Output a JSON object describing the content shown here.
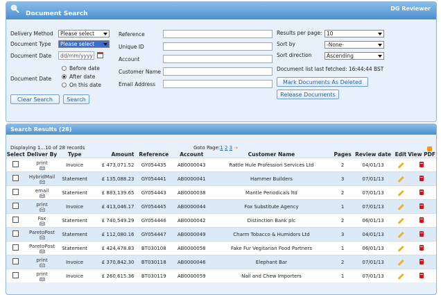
{
  "search_panel": {
    "title": "Document Search",
    "user": "DG Reviewer",
    "delivery_method_label": "Delivery Method",
    "delivery_method_value": "Please select",
    "document_type_label": "Document Type",
    "document_type_value": "Please select",
    "document_date_label": "Document Date",
    "document_date_placeholder": "dd/mm/yyyy",
    "document_date_label2": "Document Date",
    "radio_before": "Before date",
    "radio_after": "After date",
    "radio_on": "On this date",
    "clear_button": "Clear Search",
    "search_button": "Search",
    "reference_label": "Reference",
    "unique_id_label": "Unique ID",
    "account_label": "Account",
    "customer_name_label": "Customer Name",
    "email_label": "Email Address",
    "results_per_page_label": "Results per page:",
    "results_per_page_value": "10",
    "sort_by_label": "Sort by",
    "sort_by_value": "-None-",
    "sort_direction_label": "Sort direction",
    "sort_direction_value": "Ascending",
    "last_fetched": "Document list last fetched: 16:44:44 BST",
    "mark_deleted_button": "Mark Documents As Deleted",
    "release_button": "Release Documents"
  },
  "results": {
    "title": "Search Results (28)",
    "displaying": "Displaying 1...10 of 28 records",
    "goto_label": "Goto Page:",
    "pages": [
      "1",
      "2",
      "3"
    ],
    "columns": [
      "Select",
      "Deliver By",
      "Type",
      "Amount",
      "Reference",
      "Account",
      "Customer Name",
      "Pages",
      "Review date",
      "Edit",
      "View PDF"
    ],
    "rows": [
      {
        "deliver": "print",
        "type": "Invoice",
        "amount": "£ 473,071.52",
        "reference": "GY054435",
        "account": "AB0000043",
        "customer": "Rattle Hule Profession Services Ltd",
        "pages": "2",
        "review_date": "04/01/13"
      },
      {
        "deliver": "HybridMail",
        "type": "Statement",
        "amount": "£ 135,088.23",
        "reference": "GY054441",
        "account": "AB0000041",
        "customer": "Hammer Builders",
        "pages": "3",
        "review_date": "07/01/13"
      },
      {
        "deliver": "email",
        "type": "Statement",
        "amount": "£ 883,139.65",
        "reference": "GY054443",
        "account": "AB0000038",
        "customer": "Mantle Periodicals ltd",
        "pages": "2",
        "review_date": "07/01/13"
      },
      {
        "deliver": "print",
        "type": "Invoice",
        "amount": "£ 413,046.17",
        "reference": "GY054445",
        "account": "AB0000044",
        "customer": "Fox Substitute Agency",
        "pages": "1",
        "review_date": "07/01/13"
      },
      {
        "deliver": "Fax",
        "type": "Statement",
        "amount": "£ 740,549.29",
        "reference": "GY054446",
        "account": "AB0000042",
        "customer": "Distinction Bank plc",
        "pages": "2",
        "review_date": "06/01/13"
      },
      {
        "deliver": "ParetoPost",
        "type": "Statement",
        "amount": "£ 112,080.16",
        "reference": "GY054447",
        "account": "AB0000049",
        "customer": "Charm Tobacco & Humidors Ltd",
        "pages": "3",
        "review_date": "04/01/13"
      },
      {
        "deliver": "ParetoPost",
        "type": "Statement",
        "amount": "£ 424,478.83",
        "reference": "BT030108",
        "account": "AB0000058",
        "customer": "Fake Fur Vegitarian Food Partners",
        "pages": "1",
        "review_date": "06/01/13"
      },
      {
        "deliver": "print",
        "type": "Invoice",
        "amount": "£ 370,842.30",
        "reference": "BT030118",
        "account": "AB0000046",
        "customer": "Elephant Bar",
        "pages": "2",
        "review_date": "07/01/13"
      },
      {
        "deliver": "print",
        "type": "Invoice",
        "amount": "£ 260,615.36",
        "reference": "BT030119",
        "account": "AB0000059",
        "customer": "Nail and Chew Importers",
        "pages": "1",
        "review_date": "07/01/13"
      }
    ]
  },
  "colors": {
    "header": "#4a8fd0",
    "row_alt": "#dce9f6",
    "link": "#1f5fae"
  }
}
